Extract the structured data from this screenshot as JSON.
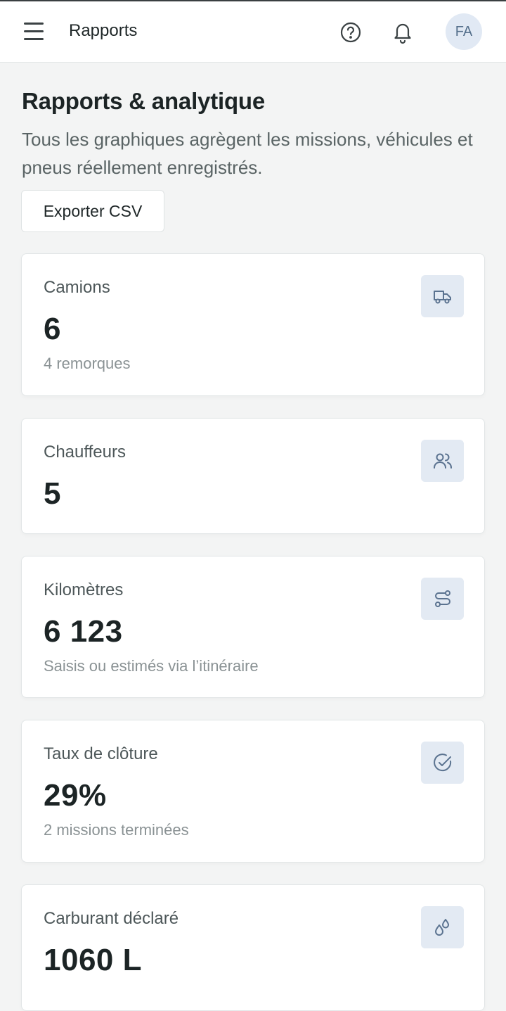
{
  "appbar": {
    "title": "Rapports",
    "menu_icon": "hamburger-menu-icon",
    "help_icon": "help-circle-icon",
    "notification_icon": "bell-icon",
    "avatar_initials": "FA"
  },
  "header": {
    "title": "Rapports & analytique",
    "subtitle": "Tous les graphiques agrègent les missions, véhicules et pneus réellement enregistrés.",
    "export_label": "Exporter CSV"
  },
  "cards": [
    {
      "label": "Camions",
      "value": "6",
      "sub": "4 remorques",
      "icon": "truck-icon"
    },
    {
      "label": "Chauffeurs",
      "value": "5",
      "sub": "",
      "icon": "users-icon"
    },
    {
      "label": "Kilomètres",
      "value": "6 123",
      "sub": "Saisis ou estimés via l’itinéraire",
      "icon": "route-icon"
    },
    {
      "label": "Taux de clôture",
      "value": "29%",
      "sub": "2 missions terminées",
      "icon": "check-circle-icon"
    },
    {
      "label": "Carburant déclaré",
      "value": "1060 L",
      "sub": "",
      "icon": "fuel-drops-icon"
    }
  ],
  "colors": {
    "background": "#f3f4f4",
    "card": "#ffffff",
    "icon_badge": "#e3eaf3",
    "icon_stroke": "#5b7390",
    "text_primary": "#1c2425",
    "text_muted": "#8a9294"
  }
}
